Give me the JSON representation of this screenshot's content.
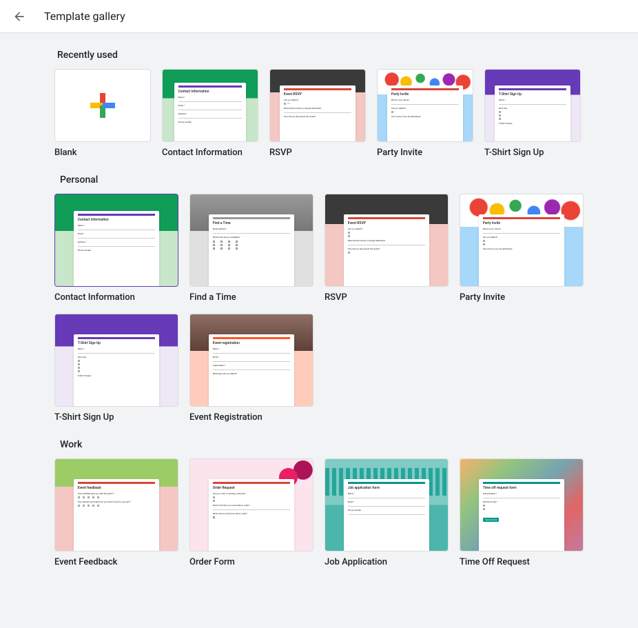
{
  "header": {
    "title": "Template gallery"
  },
  "sections": {
    "recently_used": {
      "title": "Recently used",
      "items": [
        {
          "label": "Blank",
          "preview_title": ""
        },
        {
          "label": "Contact Information",
          "preview_title": "Contact Information"
        },
        {
          "label": "RSVP",
          "preview_title": "Event RSVP"
        },
        {
          "label": "Party Invite",
          "preview_title": "Party Invite"
        },
        {
          "label": "T-Shirt Sign Up",
          "preview_title": "T-Shirt Sign Up"
        }
      ]
    },
    "personal": {
      "title": "Personal",
      "items": [
        {
          "label": "Contact Information",
          "preview_title": "Contact Information"
        },
        {
          "label": "Find a Time",
          "preview_title": "Find a Time"
        },
        {
          "label": "RSVP",
          "preview_title": "Event RSVP"
        },
        {
          "label": "Party Invite",
          "preview_title": "Party Invite"
        },
        {
          "label": "T-Shirt Sign Up",
          "preview_title": "T-Shirt Sign Up"
        },
        {
          "label": "Event Registration",
          "preview_title": "Event registration"
        }
      ]
    },
    "work": {
      "title": "Work",
      "items": [
        {
          "label": "Event Feedback",
          "preview_title": "Event feedback"
        },
        {
          "label": "Order Form",
          "preview_title": "Order Request"
        },
        {
          "label": "Job Application",
          "preview_title": "Job application form"
        },
        {
          "label": "Time Off Request",
          "preview_title": "Time off request form"
        }
      ]
    }
  },
  "preview_fields": {
    "contact": [
      "Name *",
      "Email *",
      "Address *",
      "Phone number"
    ],
    "rsvp": [
      "Can you attend?",
      "What are the names of people attending?",
      "How did you hear about this event?"
    ],
    "party": [
      "What is your name?",
      "Can you attend?",
      "How many of you are attending?"
    ],
    "tshirt": [
      "Name *",
      "Shirt size",
      "T-Shirt Preview"
    ],
    "findtime": [
      "Email address *",
      "What times are you available?"
    ],
    "eventreg": [
      "Name *",
      "Email *",
      "Organization *",
      "What days will you attend?"
    ],
    "feedback": [
      "How satisfied were you with the event? *",
      "How relevant and helpful do you think it was for your job? *"
    ],
    "order": [
      "Are you a new or existing customer?",
      "What is the item you would like to order?",
      "What color(s) would you like to order?"
    ],
    "job": [
      "Name *",
      "Email *",
      "Phone number"
    ],
    "timeoff": [
      "Leave Date(s) *",
      "All/Part All day *",
      "Type of leave"
    ]
  }
}
